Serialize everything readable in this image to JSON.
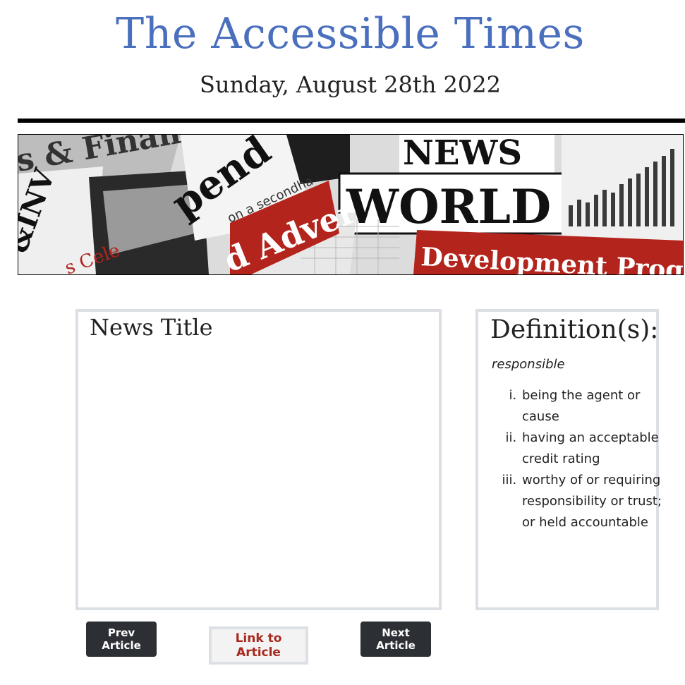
{
  "header": {
    "title": "The Accessible Times",
    "date": "Sunday, August 28th 2022"
  },
  "banner": {
    "texts": [
      "s & Finan",
      "&INV",
      "pend",
      "on a secondha",
      "d Advert",
      "NEWS",
      "WORLD",
      "Development Programme",
      "s Cele"
    ]
  },
  "article": {
    "title": "News Title"
  },
  "definitions": {
    "heading": "Definition(s):",
    "word": "responsible",
    "items": [
      "being the agent or cause",
      "having an acceptable credit rating",
      "worthy of or requiring responsibility or trust; or held accountable"
    ]
  },
  "nav": {
    "prev_label": "Prev Article",
    "link_label": "Link to Article",
    "next_label": "Next Article"
  },
  "colors": {
    "title": "#4a6fbd",
    "dark_button": "#2c2f34",
    "link_text": "#a8281e",
    "box_border": "#dcdfe4"
  }
}
